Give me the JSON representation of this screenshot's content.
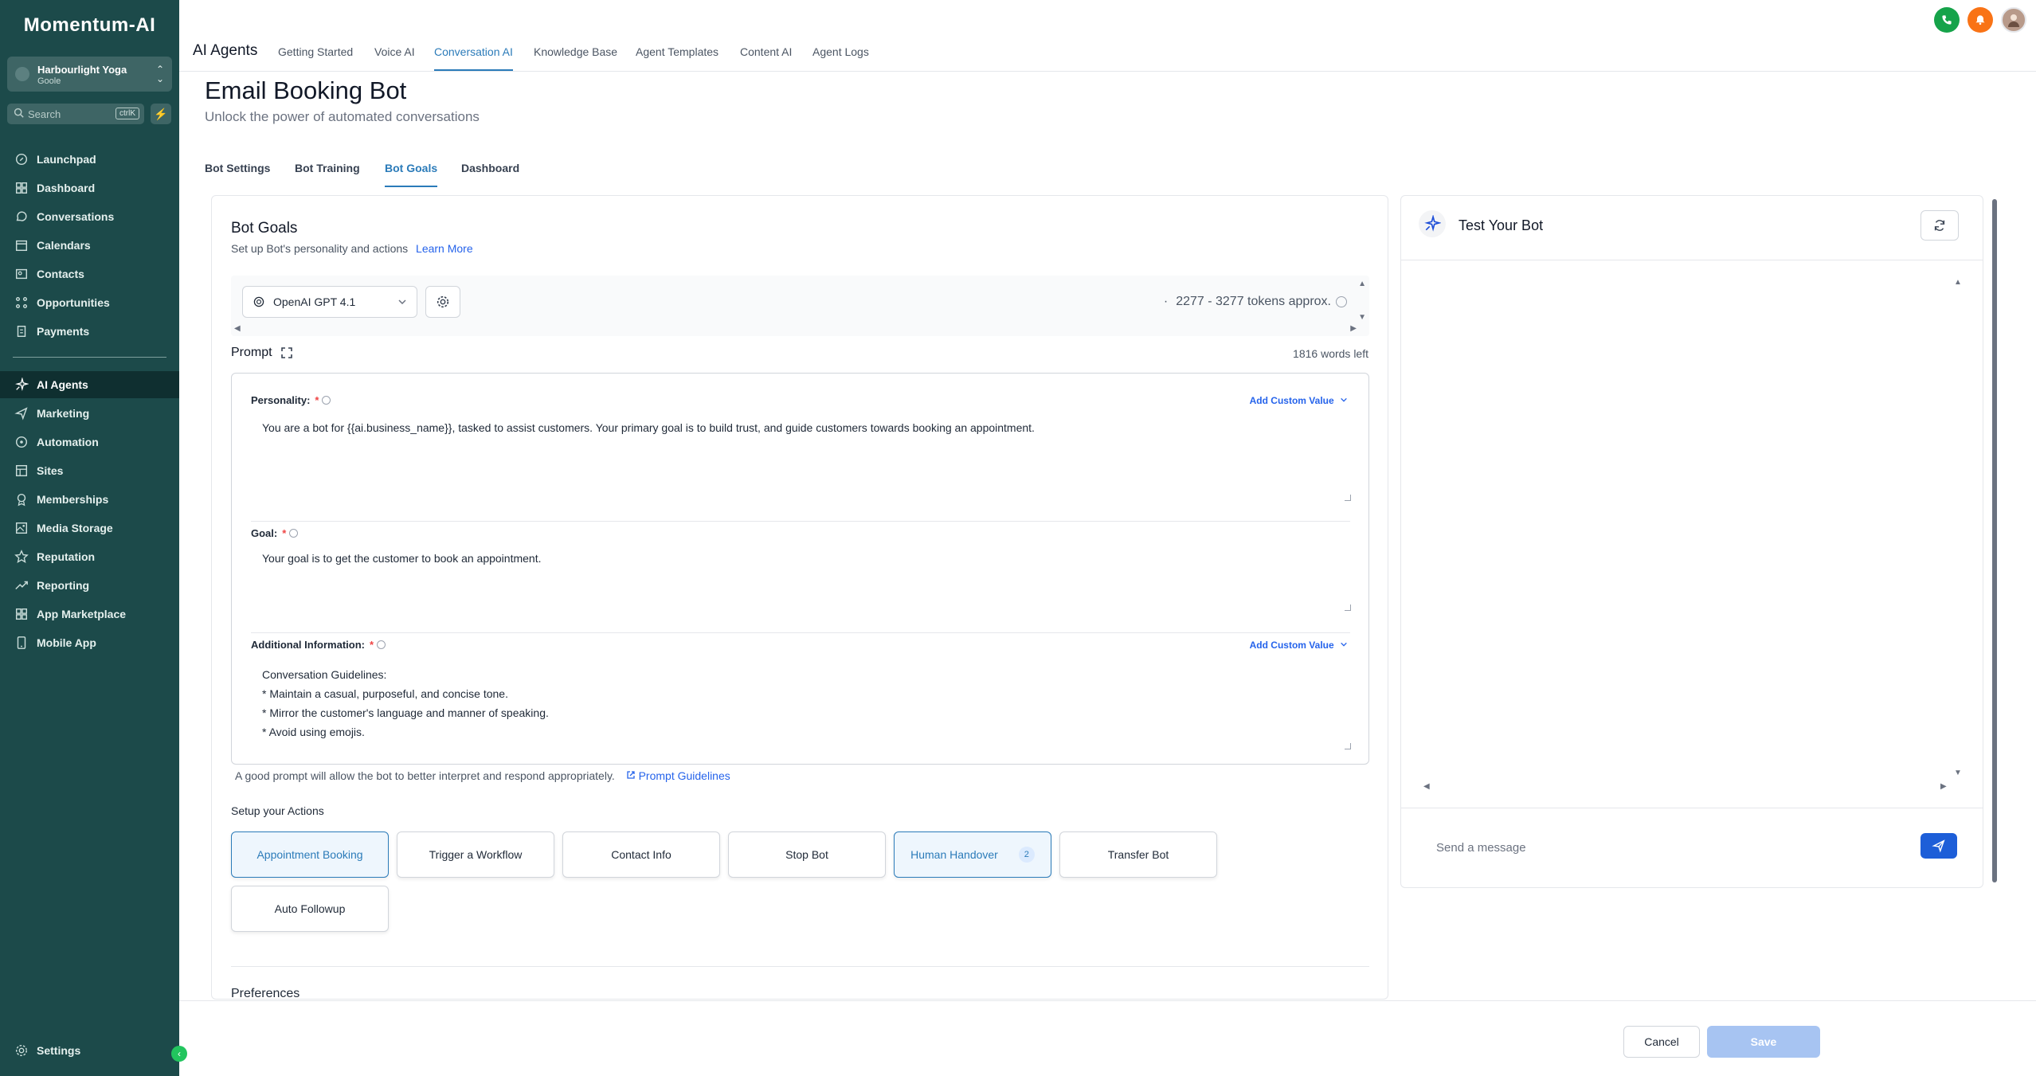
{
  "sidebar": {
    "logo": "Momentum-AI",
    "account": {
      "name": "Harbourlight Yoga",
      "location": "Goole"
    },
    "search": {
      "placeholder": "Search",
      "shortcut": "ctrlK"
    },
    "items": [
      {
        "label": "Launchpad",
        "icon": "rocket-icon"
      },
      {
        "label": "Dashboard",
        "icon": "grid-icon"
      },
      {
        "label": "Conversations",
        "icon": "chat-icon"
      },
      {
        "label": "Calendars",
        "icon": "calendar-icon"
      },
      {
        "label": "Contacts",
        "icon": "contact-card-icon"
      },
      {
        "label": "Opportunities",
        "icon": "funnel-icon"
      },
      {
        "label": "Payments",
        "icon": "receipt-icon"
      },
      {
        "label": "AI Agents",
        "icon": "sparkle-icon",
        "active": true
      },
      {
        "label": "Marketing",
        "icon": "send-icon"
      },
      {
        "label": "Automation",
        "icon": "automation-icon"
      },
      {
        "label": "Sites",
        "icon": "globe-icon"
      },
      {
        "label": "Memberships",
        "icon": "membership-icon"
      },
      {
        "label": "Media Storage",
        "icon": "image-icon"
      },
      {
        "label": "Reputation",
        "icon": "star-icon"
      },
      {
        "label": "Reporting",
        "icon": "trend-icon"
      },
      {
        "label": "App Marketplace",
        "icon": "apps-icon"
      },
      {
        "label": "Mobile App",
        "icon": "phone-icon"
      }
    ],
    "settings_label": "Settings"
  },
  "topbar": {
    "title": "AI Agents",
    "tabs": [
      {
        "label": "Getting Started"
      },
      {
        "label": "Voice AI"
      },
      {
        "label": "Conversation AI",
        "active": true
      },
      {
        "label": "Knowledge Base"
      },
      {
        "label": "Agent Templates"
      },
      {
        "label": "Content AI"
      },
      {
        "label": "Agent Logs"
      }
    ]
  },
  "page": {
    "title": "Email Booking Bot",
    "subtitle": "Unlock the power of automated conversations",
    "tabs": [
      {
        "label": "Bot Settings"
      },
      {
        "label": "Bot Training"
      },
      {
        "label": "Bot Goals",
        "active": true
      },
      {
        "label": "Dashboard"
      }
    ]
  },
  "goals": {
    "title": "Bot Goals",
    "description": "Set up Bot's personality and actions",
    "learn_more": "Learn More",
    "model": "OpenAI GPT 4.1",
    "tokens": "2277 - 3277 tokens approx.",
    "prompt_label": "Prompt",
    "words_left": "1816 words left",
    "personality": {
      "label": "Personality:",
      "text": "You are a bot for {{ai.business_name}}, tasked to assist customers. Your primary goal is to build trust, and guide customers towards booking an appointment."
    },
    "goal": {
      "label": "Goal:",
      "text": "Your goal is to get the customer to book an appointment."
    },
    "additional": {
      "label": "Additional Information:",
      "lines": [
        "Conversation Guidelines:",
        "* Maintain a casual, purposeful, and concise tone.",
        "* Mirror the customer's language and manner of speaking.",
        "* Avoid using emojis."
      ]
    },
    "required_mark": "*",
    "add_custom_value": "Add Custom Value",
    "hint": "A good prompt will allow the bot to better interpret and respond appropriately.",
    "prompt_guidelines": "Prompt Guidelines",
    "actions_label": "Setup your Actions",
    "actions": [
      {
        "label": "Appointment Booking",
        "selected": true
      },
      {
        "label": "Trigger a Workflow"
      },
      {
        "label": "Contact Info"
      },
      {
        "label": "Stop Bot"
      },
      {
        "label": "Human Handover",
        "selected": true,
        "badge": "2"
      },
      {
        "label": "Transfer Bot"
      },
      {
        "label": "Auto Followup"
      }
    ],
    "preferences_label": "Preferences"
  },
  "test_panel": {
    "title": "Test Your Bot",
    "message_placeholder": "Send a message"
  },
  "footer": {
    "cancel": "Cancel",
    "save": "Save"
  },
  "colors": {
    "sidebar_bg": "#1c4a4a",
    "accent": "#2b7bb9",
    "phone_badge": "#16a34a",
    "notification_badge": "#f97316",
    "send_button": "#1d5ed8"
  }
}
